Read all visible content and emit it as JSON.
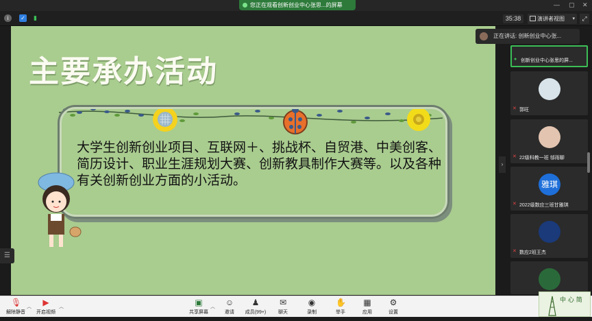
{
  "titlebar": {
    "share_notice": "您正在观看创新创业中心张思...的屏幕",
    "minimize": "—",
    "maximize": "▢",
    "close": "✕"
  },
  "toolbar": {
    "timer": "35:38",
    "view_mode": "演讲者视图",
    "expand": "⤢"
  },
  "speaker": {
    "label": "正在讲话: 创新创业中心张..."
  },
  "slide": {
    "title": "主要承办活动",
    "body": "大学生创新创业项目、互联网＋、挑战杯、自贸港、中美创客、简历设计、职业生涯规划大赛、创新教具制作大赛等。以及各种有关创新创业方面的小活动。"
  },
  "participants": [
    {
      "name": "创新创业中心张思的屏...",
      "active": true
    },
    {
      "name": "郭旺",
      "active": false
    },
    {
      "name": "22级科教一班 邬雨聊",
      "active": false
    },
    {
      "name": "2022级数应三班甘雅琪",
      "active": false,
      "avatar_text": "雅琪",
      "avatar_color": "#1e6fd9"
    },
    {
      "name": "数应2班王杰",
      "active": false
    },
    {
      "name": "",
      "active": false
    }
  ],
  "bottombar": {
    "mute": "解除静音",
    "video": "开启视频",
    "share": "共享屏幕",
    "invite": "邀请",
    "members": "成员(99+)",
    "chat": "聊天",
    "record": "录制",
    "raise_hand": "举手",
    "apps": "应用",
    "settings": "设置"
  },
  "logo": {
    "text": "中 心 简"
  },
  "colors": {
    "slide_bg": "#a9cc8f",
    "share_green": "#2d7a3a",
    "active_border": "#3cbf57",
    "muted_red": "#e04444"
  }
}
